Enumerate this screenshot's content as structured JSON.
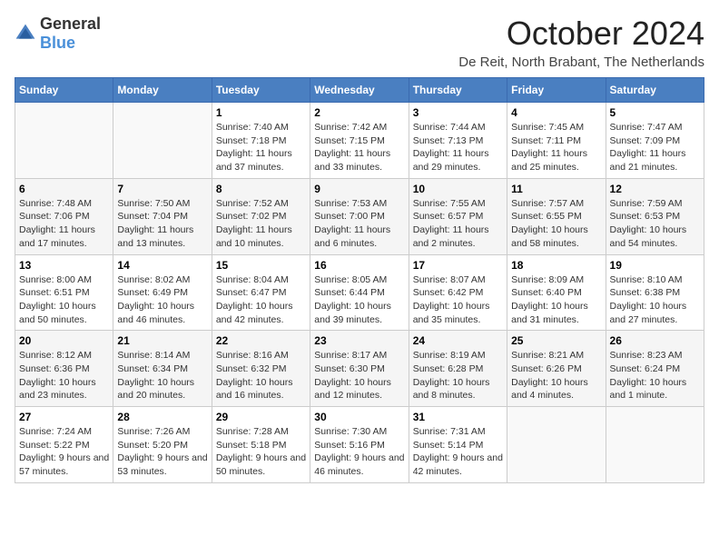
{
  "header": {
    "logo_general": "General",
    "logo_blue": "Blue",
    "month_title": "October 2024",
    "location": "De Reit, North Brabant, The Netherlands"
  },
  "weekdays": [
    "Sunday",
    "Monday",
    "Tuesday",
    "Wednesday",
    "Thursday",
    "Friday",
    "Saturday"
  ],
  "weeks": [
    [
      {
        "day": "",
        "sunrise": "",
        "sunset": "",
        "daylight": ""
      },
      {
        "day": "",
        "sunrise": "",
        "sunset": "",
        "daylight": ""
      },
      {
        "day": "1",
        "sunrise": "Sunrise: 7:40 AM",
        "sunset": "Sunset: 7:18 PM",
        "daylight": "Daylight: 11 hours and 37 minutes."
      },
      {
        "day": "2",
        "sunrise": "Sunrise: 7:42 AM",
        "sunset": "Sunset: 7:15 PM",
        "daylight": "Daylight: 11 hours and 33 minutes."
      },
      {
        "day": "3",
        "sunrise": "Sunrise: 7:44 AM",
        "sunset": "Sunset: 7:13 PM",
        "daylight": "Daylight: 11 hours and 29 minutes."
      },
      {
        "day": "4",
        "sunrise": "Sunrise: 7:45 AM",
        "sunset": "Sunset: 7:11 PM",
        "daylight": "Daylight: 11 hours and 25 minutes."
      },
      {
        "day": "5",
        "sunrise": "Sunrise: 7:47 AM",
        "sunset": "Sunset: 7:09 PM",
        "daylight": "Daylight: 11 hours and 21 minutes."
      }
    ],
    [
      {
        "day": "6",
        "sunrise": "Sunrise: 7:48 AM",
        "sunset": "Sunset: 7:06 PM",
        "daylight": "Daylight: 11 hours and 17 minutes."
      },
      {
        "day": "7",
        "sunrise": "Sunrise: 7:50 AM",
        "sunset": "Sunset: 7:04 PM",
        "daylight": "Daylight: 11 hours and 13 minutes."
      },
      {
        "day": "8",
        "sunrise": "Sunrise: 7:52 AM",
        "sunset": "Sunset: 7:02 PM",
        "daylight": "Daylight: 11 hours and 10 minutes."
      },
      {
        "day": "9",
        "sunrise": "Sunrise: 7:53 AM",
        "sunset": "Sunset: 7:00 PM",
        "daylight": "Daylight: 11 hours and 6 minutes."
      },
      {
        "day": "10",
        "sunrise": "Sunrise: 7:55 AM",
        "sunset": "Sunset: 6:57 PM",
        "daylight": "Daylight: 11 hours and 2 minutes."
      },
      {
        "day": "11",
        "sunrise": "Sunrise: 7:57 AM",
        "sunset": "Sunset: 6:55 PM",
        "daylight": "Daylight: 10 hours and 58 minutes."
      },
      {
        "day": "12",
        "sunrise": "Sunrise: 7:59 AM",
        "sunset": "Sunset: 6:53 PM",
        "daylight": "Daylight: 10 hours and 54 minutes."
      }
    ],
    [
      {
        "day": "13",
        "sunrise": "Sunrise: 8:00 AM",
        "sunset": "Sunset: 6:51 PM",
        "daylight": "Daylight: 10 hours and 50 minutes."
      },
      {
        "day": "14",
        "sunrise": "Sunrise: 8:02 AM",
        "sunset": "Sunset: 6:49 PM",
        "daylight": "Daylight: 10 hours and 46 minutes."
      },
      {
        "day": "15",
        "sunrise": "Sunrise: 8:04 AM",
        "sunset": "Sunset: 6:47 PM",
        "daylight": "Daylight: 10 hours and 42 minutes."
      },
      {
        "day": "16",
        "sunrise": "Sunrise: 8:05 AM",
        "sunset": "Sunset: 6:44 PM",
        "daylight": "Daylight: 10 hours and 39 minutes."
      },
      {
        "day": "17",
        "sunrise": "Sunrise: 8:07 AM",
        "sunset": "Sunset: 6:42 PM",
        "daylight": "Daylight: 10 hours and 35 minutes."
      },
      {
        "day": "18",
        "sunrise": "Sunrise: 8:09 AM",
        "sunset": "Sunset: 6:40 PM",
        "daylight": "Daylight: 10 hours and 31 minutes."
      },
      {
        "day": "19",
        "sunrise": "Sunrise: 8:10 AM",
        "sunset": "Sunset: 6:38 PM",
        "daylight": "Daylight: 10 hours and 27 minutes."
      }
    ],
    [
      {
        "day": "20",
        "sunrise": "Sunrise: 8:12 AM",
        "sunset": "Sunset: 6:36 PM",
        "daylight": "Daylight: 10 hours and 23 minutes."
      },
      {
        "day": "21",
        "sunrise": "Sunrise: 8:14 AM",
        "sunset": "Sunset: 6:34 PM",
        "daylight": "Daylight: 10 hours and 20 minutes."
      },
      {
        "day": "22",
        "sunrise": "Sunrise: 8:16 AM",
        "sunset": "Sunset: 6:32 PM",
        "daylight": "Daylight: 10 hours and 16 minutes."
      },
      {
        "day": "23",
        "sunrise": "Sunrise: 8:17 AM",
        "sunset": "Sunset: 6:30 PM",
        "daylight": "Daylight: 10 hours and 12 minutes."
      },
      {
        "day": "24",
        "sunrise": "Sunrise: 8:19 AM",
        "sunset": "Sunset: 6:28 PM",
        "daylight": "Daylight: 10 hours and 8 minutes."
      },
      {
        "day": "25",
        "sunrise": "Sunrise: 8:21 AM",
        "sunset": "Sunset: 6:26 PM",
        "daylight": "Daylight: 10 hours and 4 minutes."
      },
      {
        "day": "26",
        "sunrise": "Sunrise: 8:23 AM",
        "sunset": "Sunset: 6:24 PM",
        "daylight": "Daylight: 10 hours and 1 minute."
      }
    ],
    [
      {
        "day": "27",
        "sunrise": "Sunrise: 7:24 AM",
        "sunset": "Sunset: 5:22 PM",
        "daylight": "Daylight: 9 hours and 57 minutes."
      },
      {
        "day": "28",
        "sunrise": "Sunrise: 7:26 AM",
        "sunset": "Sunset: 5:20 PM",
        "daylight": "Daylight: 9 hours and 53 minutes."
      },
      {
        "day": "29",
        "sunrise": "Sunrise: 7:28 AM",
        "sunset": "Sunset: 5:18 PM",
        "daylight": "Daylight: 9 hours and 50 minutes."
      },
      {
        "day": "30",
        "sunrise": "Sunrise: 7:30 AM",
        "sunset": "Sunset: 5:16 PM",
        "daylight": "Daylight: 9 hours and 46 minutes."
      },
      {
        "day": "31",
        "sunrise": "Sunrise: 7:31 AM",
        "sunset": "Sunset: 5:14 PM",
        "daylight": "Daylight: 9 hours and 42 minutes."
      },
      {
        "day": "",
        "sunrise": "",
        "sunset": "",
        "daylight": ""
      },
      {
        "day": "",
        "sunrise": "",
        "sunset": "",
        "daylight": ""
      }
    ]
  ]
}
